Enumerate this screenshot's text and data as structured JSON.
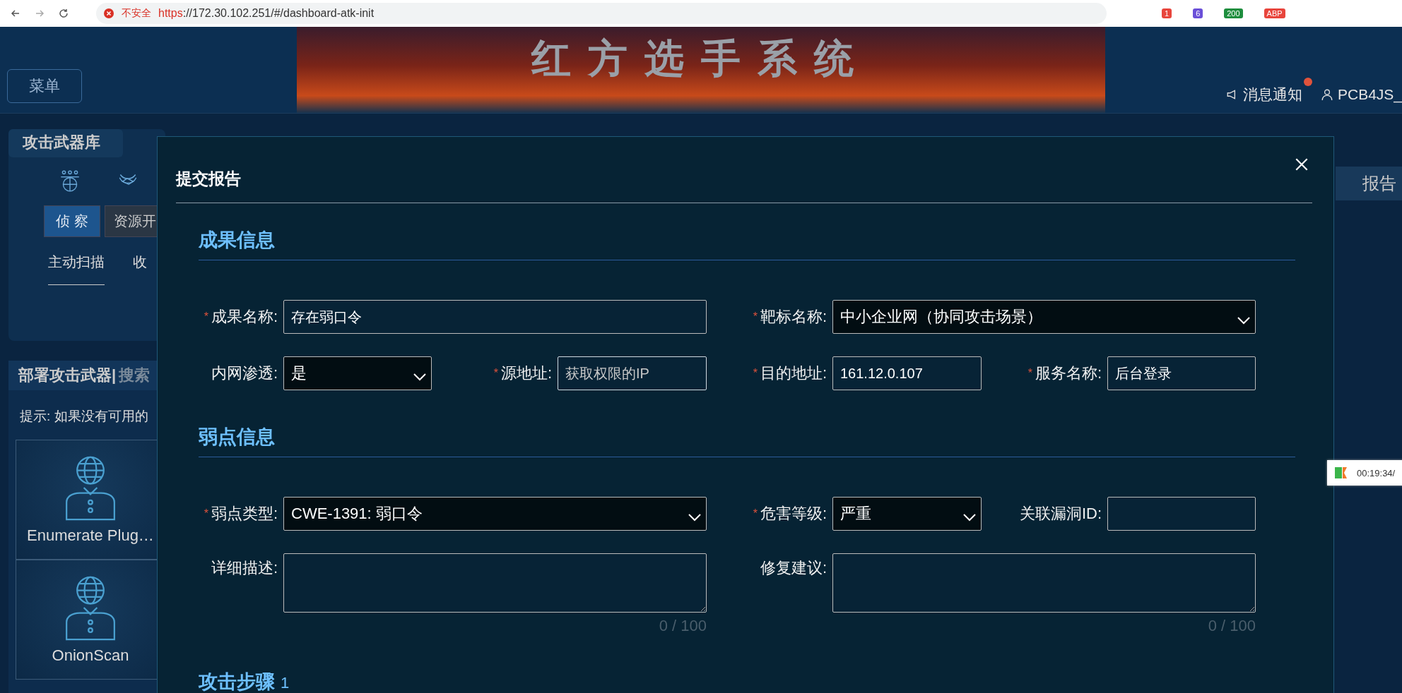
{
  "browser": {
    "security_label": "不安全",
    "url_scheme": "https",
    "url_rest": "://172.30.102.251/#/dashboard-atk-init",
    "extension_badges": [
      {
        "text": "1",
        "color": "#e8453c"
      },
      {
        "text": "6",
        "color": "#6a4fd8"
      },
      {
        "text": "200",
        "color": "#1e8e3e"
      },
      {
        "text": "ABP",
        "color": "#e8453c"
      }
    ]
  },
  "header": {
    "menu_label": "菜单",
    "title": "红方选手系统",
    "notification_label": "消息通知",
    "notification_unread": true,
    "user": "PCB4JS_"
  },
  "left_panel": {
    "library_title": "攻击武器库",
    "categories": [
      {
        "label": "侦 察",
        "selected": true
      },
      {
        "label": "资源开",
        "selected": false
      }
    ],
    "subtabs": [
      {
        "label": "主动扫描",
        "selected": true
      },
      {
        "label": "收",
        "selected": false
      }
    ],
    "deploy_title": "部署攻击武器|",
    "search_label": "搜索",
    "hint": "提示: 如果没有可用的",
    "tools": [
      {
        "name": "Enumerate Plug…"
      },
      {
        "name": "OnionScan"
      }
    ]
  },
  "modal": {
    "title": "提交报告",
    "sections": [
      {
        "heading": "成果信息",
        "rows": [
          {
            "fields": [
              {
                "kind": "input",
                "label": "成果名称:",
                "required_mark": "*",
                "value": "存在弱口令"
              },
              {
                "kind": "select",
                "label": "靶标名称:",
                "required_mark": "*",
                "value": "中小企业网（协同攻击场景）"
              }
            ]
          },
          {
            "fields": [
              {
                "kind": "select",
                "label": "内网渗透:",
                "value": "是"
              },
              {
                "kind": "input",
                "label": "源地址:",
                "required_mark": "*",
                "placeholder": "获取权限的IP"
              },
              {
                "kind": "input",
                "label": "目的地址:",
                "required_mark": "*",
                "value": "161.12.0.107"
              },
              {
                "kind": "input",
                "label": "服务名称:",
                "required_mark": "*",
                "value": "后台登录"
              }
            ]
          }
        ]
      },
      {
        "heading": "弱点信息",
        "rows": [
          {
            "fields": [
              {
                "kind": "select",
                "label": "弱点类型:",
                "required_mark": "*",
                "value": "CWE-1391: 弱口令"
              },
              {
                "kind": "select",
                "label": "危害等级:",
                "required_mark": "*",
                "value": "严重"
              },
              {
                "kind": "input",
                "label": "关联漏洞ID:"
              }
            ]
          },
          {
            "fields": [
              {
                "kind": "textarea",
                "label": "详细描述:",
                "counter": "0 / 100"
              },
              {
                "kind": "textarea",
                "label": "修复建议:",
                "counter": "0 / 100"
              }
            ]
          }
        ]
      },
      {
        "heading": "攻击步骤",
        "number": "1"
      }
    ]
  },
  "right_panel": {
    "tab_label": "报告"
  },
  "timer": {
    "text": "00:19:34/"
  }
}
